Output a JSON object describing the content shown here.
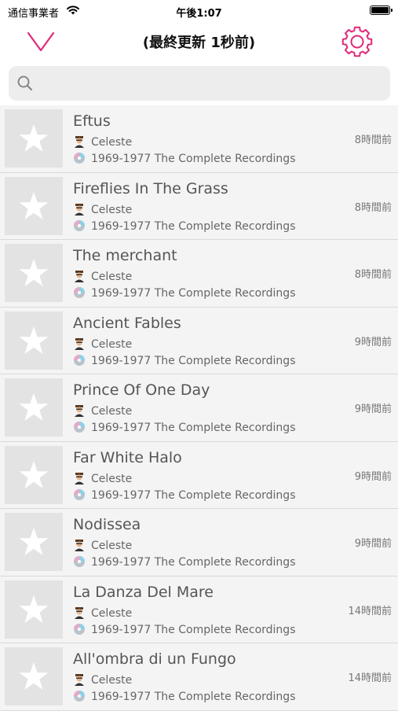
{
  "status_bar": {
    "carrier": "通信事業者",
    "time": "午後1:07"
  },
  "nav": {
    "title": "(最終更新 1秒前)"
  },
  "search": {
    "placeholder": ""
  },
  "colors": {
    "accent": "#e0297a",
    "row_bg": "#f4f4f4",
    "thumb_bg": "#e3e3e3"
  },
  "tracks": [
    {
      "title": "Eftus",
      "artist": "Celeste",
      "album": "1969-1977 The Complete Recordings",
      "time": "8時間前"
    },
    {
      "title": "Fireflies In The Grass",
      "artist": "Celeste",
      "album": "1969-1977 The Complete Recordings",
      "time": "8時間前"
    },
    {
      "title": "The merchant",
      "artist": "Celeste",
      "album": "1969-1977 The Complete Recordings",
      "time": "8時間前"
    },
    {
      "title": "Ancient Fables",
      "artist": "Celeste",
      "album": "1969-1977 The Complete Recordings",
      "time": "9時間前"
    },
    {
      "title": "Prince Of One Day",
      "artist": "Celeste",
      "album": "1969-1977 The Complete Recordings",
      "time": "9時間前"
    },
    {
      "title": "Far White Halo",
      "artist": "Celeste",
      "album": "1969-1977 The Complete Recordings",
      "time": "9時間前"
    },
    {
      "title": "Nodissea",
      "artist": "Celeste",
      "album": "1969-1977 The Complete Recordings",
      "time": "9時間前"
    },
    {
      "title": "La Danza Del Mare",
      "artist": "Celeste",
      "album": "1969-1977 The Complete Recordings",
      "time": "14時間前"
    },
    {
      "title": "All'ombra di un Fungo",
      "artist": "Celeste",
      "album": "1969-1977 The Complete Recordings",
      "time": "14時間前"
    }
  ]
}
